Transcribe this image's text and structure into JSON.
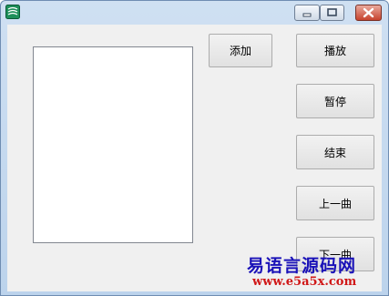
{
  "window": {
    "icons": {
      "app": "app-icon",
      "minimize": "minimize-icon",
      "maximize": "maximize-icon",
      "close": "close-icon"
    }
  },
  "playlist": {
    "items": []
  },
  "buttons": {
    "add": "添加",
    "play": "播放",
    "pause": "暂停",
    "stop": "结束",
    "prev": "上一曲",
    "next": "下一曲"
  },
  "watermark": {
    "name": "易语言源码网",
    "url": "www.e5a5x.com"
  },
  "colors": {
    "watermark_name": "#1a12b8",
    "watermark_url": "#d01818",
    "close_button": "#c7432e"
  }
}
